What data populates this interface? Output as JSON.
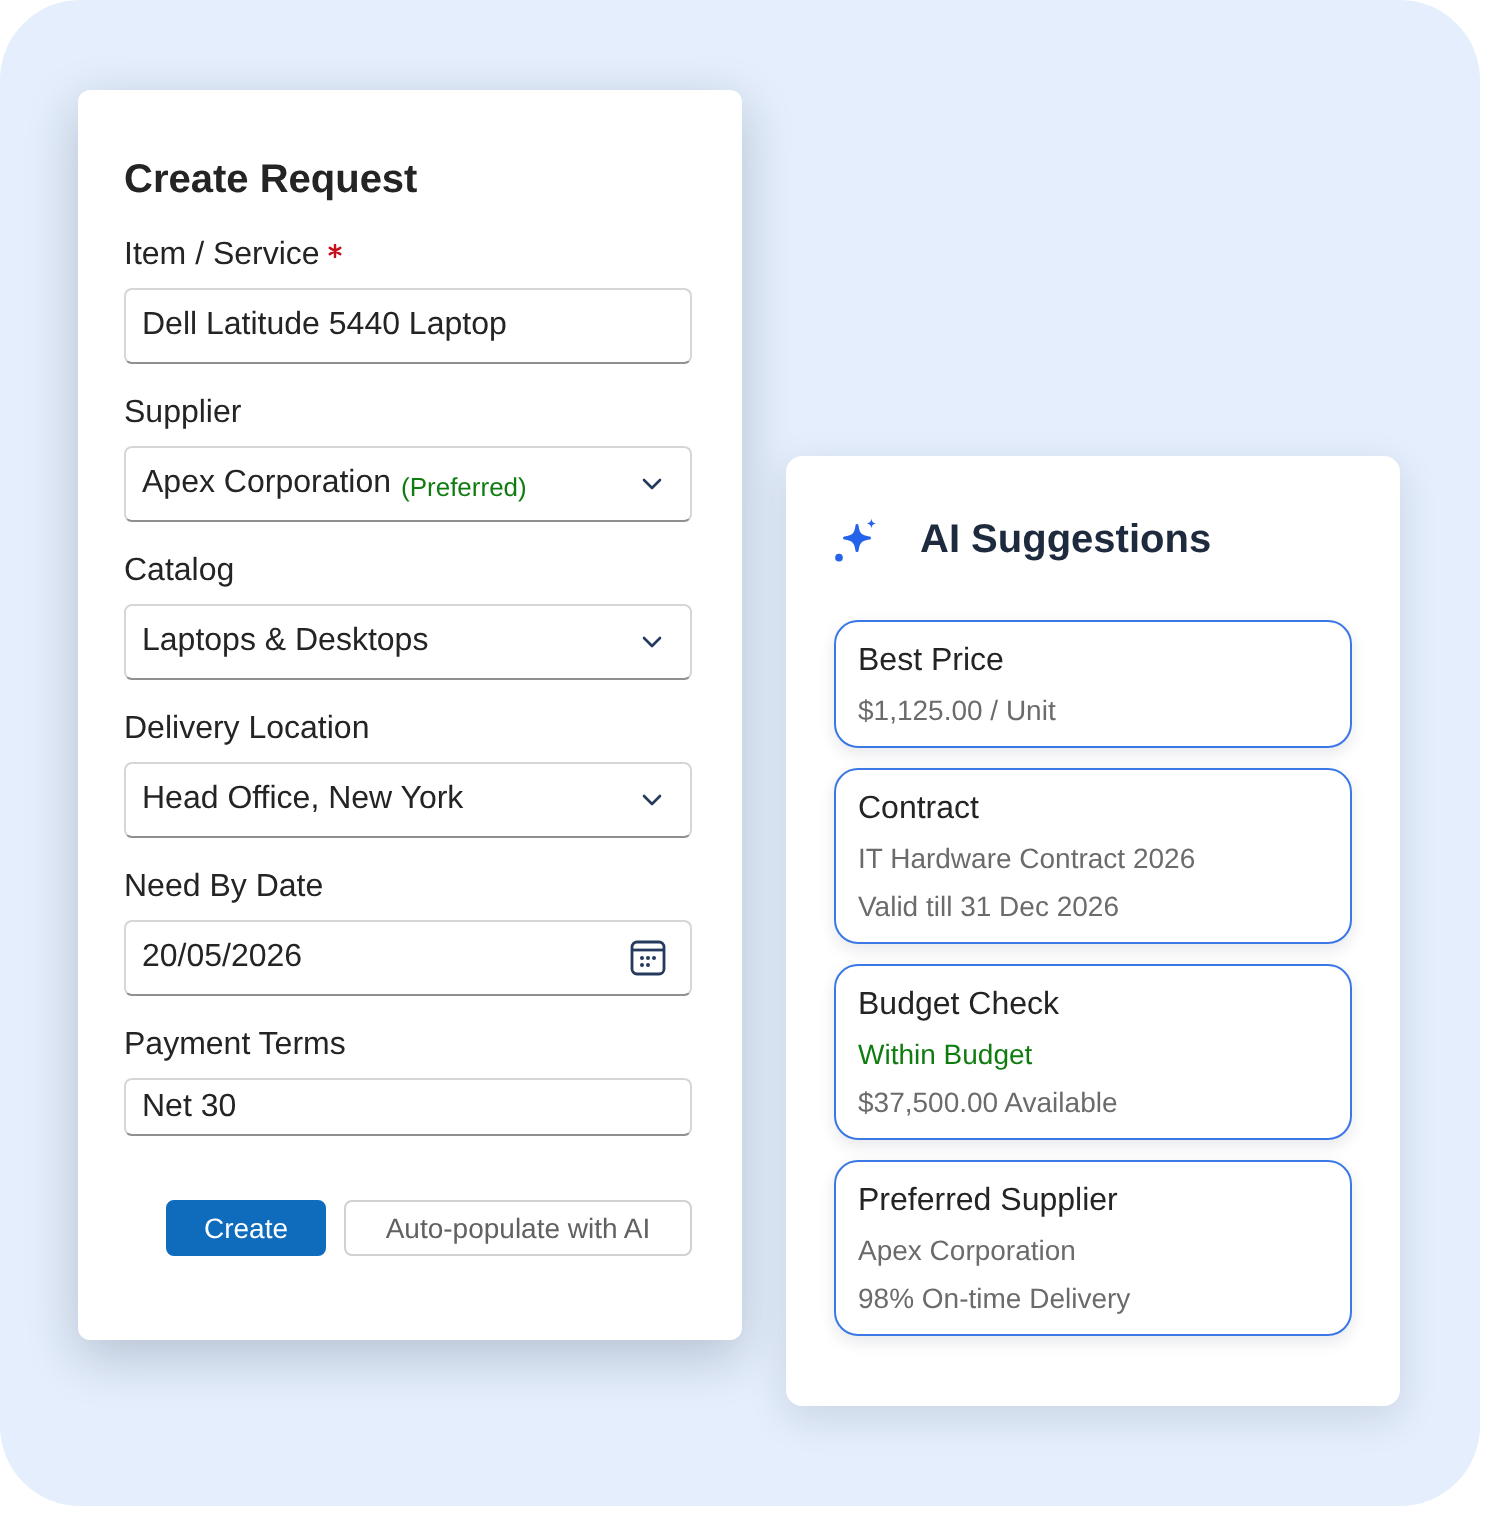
{
  "form": {
    "title": "Create Request",
    "fields": [
      {
        "kind": "text",
        "label": "Item / Service",
        "required": true,
        "value": "Dell Latitude 5440 Laptop"
      },
      {
        "kind": "select",
        "label": "Supplier",
        "required": false,
        "value": "Apex Corporation",
        "note": "(Preferred)"
      },
      {
        "kind": "select",
        "label": "Catalog",
        "required": false,
        "value": "Laptops & Desktops"
      },
      {
        "kind": "select",
        "label": "Delivery Location",
        "required": false,
        "value": "Head Office, New York"
      },
      {
        "kind": "date",
        "label": "Need By Date",
        "required": false,
        "value": "20/05/2026"
      },
      {
        "kind": "text",
        "label": "Payment Terms",
        "required": false,
        "value": "Net 30"
      }
    ],
    "buttons": [
      {
        "kind": "primary",
        "label": "Create"
      },
      {
        "kind": "secondary",
        "label": "Auto-populate with AI"
      }
    ]
  },
  "suggestions": {
    "title": "AI Suggestions",
    "cards": [
      {
        "title": "Best Price",
        "lines": [
          {
            "kind": "detail",
            "text": "$1,125.00 / Unit"
          }
        ]
      },
      {
        "title": "Contract",
        "lines": [
          {
            "kind": "detail",
            "text": "IT Hardware Contract 2026"
          },
          {
            "kind": "detail",
            "text": "Valid till 31 Dec 2026"
          }
        ]
      },
      {
        "title": "Budget Check",
        "lines": [
          {
            "kind": "status",
            "text": "Within Budget"
          },
          {
            "kind": "detail",
            "text": "$37,500.00 Available"
          }
        ]
      },
      {
        "title": "Preferred Supplier",
        "lines": [
          {
            "kind": "detail",
            "text": "Apex Corporation"
          },
          {
            "kind": "detail",
            "text": "98% On-time Delivery"
          }
        ]
      }
    ]
  }
}
